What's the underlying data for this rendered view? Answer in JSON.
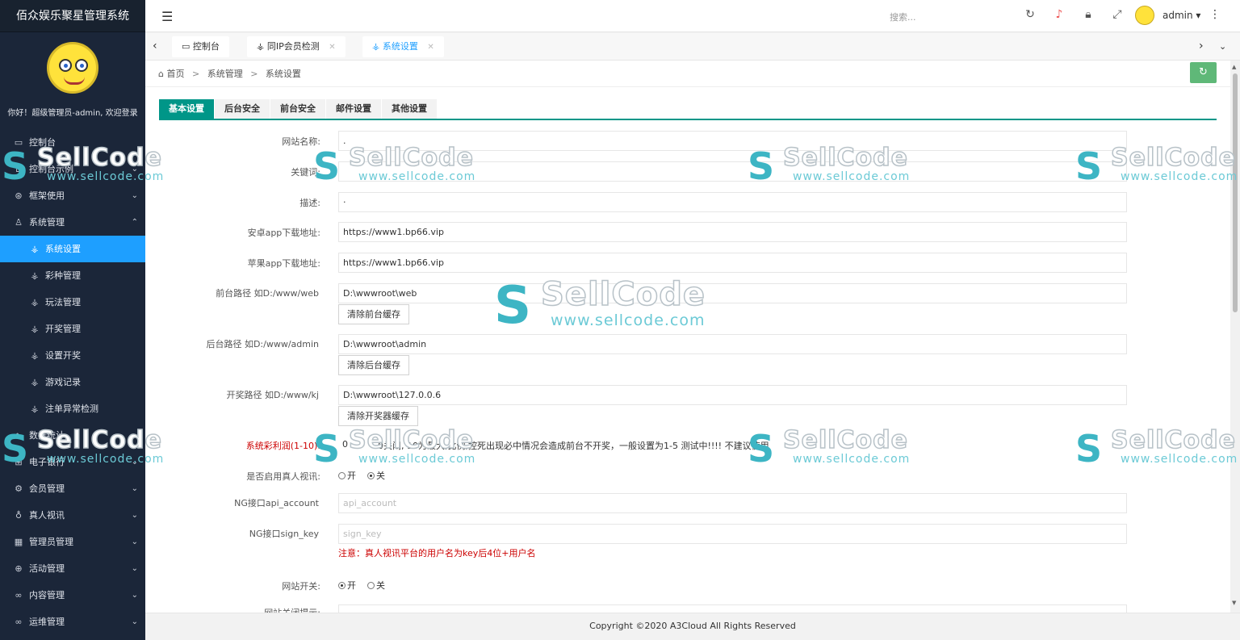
{
  "brand": "佰众娱乐聚星管理系统",
  "welcome": "你好！超级管理员-admin, 欢迎登录",
  "sidebar": {
    "items": [
      {
        "label": "控制台",
        "icon": "monitor-icon",
        "chev": ""
      },
      {
        "label": "控制台示例",
        "icon": "home-icon",
        "chev": "⌄"
      },
      {
        "label": "框架使用",
        "icon": "layers-icon",
        "chev": "⌄"
      },
      {
        "label": "系统管理",
        "icon": "user-icon",
        "chev": "⌃"
      },
      {
        "label": "系统设置",
        "icon": "antenna-icon",
        "chev": ""
      },
      {
        "label": "彩种管理",
        "icon": "antenna-icon",
        "chev": ""
      },
      {
        "label": "玩法管理",
        "icon": "antenna-icon",
        "chev": ""
      },
      {
        "label": "开奖管理",
        "icon": "antenna-icon",
        "chev": ""
      },
      {
        "label": "设置开奖",
        "icon": "antenna-icon",
        "chev": ""
      },
      {
        "label": "游戏记录",
        "icon": "antenna-icon",
        "chev": ""
      },
      {
        "label": "注单异常检测",
        "icon": "antenna-icon",
        "chev": ""
      },
      {
        "label": "数据统计",
        "icon": "pulse-icon",
        "chev": "⌄"
      },
      {
        "label": "电子银行",
        "icon": "bank-icon",
        "chev": "⌄"
      },
      {
        "label": "会员管理",
        "icon": "gear-icon",
        "chev": "⌄"
      },
      {
        "label": "真人视讯",
        "icon": "camera-icon",
        "chev": "⌄"
      },
      {
        "label": "管理员管理",
        "icon": "grid-icon",
        "chev": "⌄"
      },
      {
        "label": "活动管理",
        "icon": "plus-circle-icon",
        "chev": "⌄"
      },
      {
        "label": "内容管理",
        "icon": "link-icon",
        "chev": "⌄"
      },
      {
        "label": "运维管理",
        "icon": "link-icon",
        "chev": "⌄"
      }
    ]
  },
  "topbar": {
    "search_placeholder": "搜索...",
    "username": "admin ▾",
    "icons": [
      "refresh-icon",
      "bell-icon",
      "lock-icon",
      "fullscreen-icon"
    ]
  },
  "tabs": [
    {
      "label": "控制台",
      "icon": "monitor-icon"
    },
    {
      "label": "同IP会员检测",
      "icon": "antenna-icon"
    },
    {
      "label": "系统设置",
      "icon": "antenna-icon"
    }
  ],
  "breadcrumb": [
    "首页",
    "系统管理",
    "系统设置"
  ],
  "breadcrumb_sep": ">",
  "settings_tabs": [
    "基本设置",
    "后台安全",
    "前台安全",
    "邮件设置",
    "其他设置"
  ],
  "form": {
    "site_name": {
      "label": "网站名称:",
      "value": "."
    },
    "keywords": {
      "label": "关键词:",
      "value": ""
    },
    "description": {
      "label": "描述:",
      "value": "·"
    },
    "android_url": {
      "label": "安卓app下载地址:",
      "value": "https://www1.bp66.vip"
    },
    "ios_url": {
      "label": "苹果app下载地址:",
      "value": "https://www1.bp66.vip"
    },
    "front_path": {
      "label": "前台路径 如D:/www/web",
      "value": "D:\\wwwroot\\web",
      "button": "清除前台缓存"
    },
    "admin_path": {
      "label": "后台路径 如D:/www/admin",
      "value": "D:\\wwwroot\\admin",
      "button": "清除后台缓存"
    },
    "lottery_path": {
      "label": "开奖路径 如D:/www/kj",
      "value": "D:\\wwwroot\\127.0.0.6",
      "button": "清除开奖器缓存"
    },
    "profit": {
      "label": "系统彩利润(1-10):",
      "value": "0",
      "note": "0关闭,    10为最大,比例,控死出现必中情况会造成前台不开奖，一般设置为1-5 测试中!!!! 不建议使用"
    },
    "live_video": {
      "label": "是否启用真人视讯:",
      "on": "开",
      "off": "关",
      "selected": "off"
    },
    "ng_account": {
      "label": "NG接口api_account",
      "placeholder": "api_account"
    },
    "ng_key": {
      "label": "NG接口sign_key",
      "placeholder": "sign_key",
      "note": "注意：真人视讯平台的用户名为key后4位+用户名"
    },
    "site_switch": {
      "label": "网站开关:",
      "on": "开",
      "off": "关",
      "selected": "on"
    },
    "close_tip": {
      "label": "网站关闭提示:"
    }
  },
  "footer": "Copyright ©2020 A3Cloud All Rights Reserved",
  "watermark": {
    "brand": "SellCode",
    "url": "www.sellcode.com"
  },
  "colors": {
    "sidebar_bg": "#1b2639",
    "active": "#1e9fff",
    "tab_accent": "#009688",
    "refresh_btn": "#5fb878"
  }
}
